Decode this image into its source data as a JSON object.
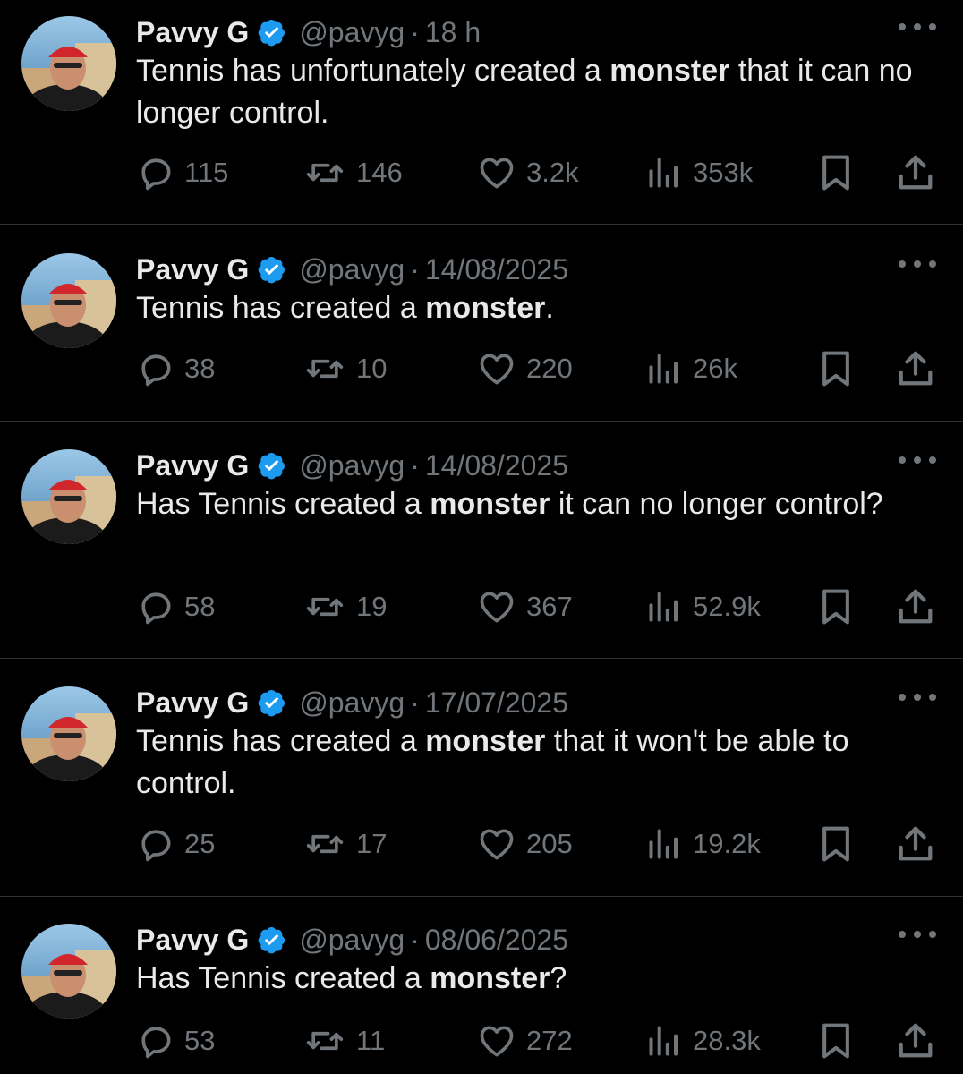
{
  "colors": {
    "background": "#000000",
    "text": "#e7e9ea",
    "muted": "#71767b",
    "verified": "#1d9bf0",
    "divider": "#2f3336"
  },
  "tweets": [
    {
      "name": "Pavvy G",
      "handle": "@pavyg",
      "separator": "·",
      "time": "18 h",
      "text_before": "Tennis has unfortunately created a ",
      "text_bold": "monster",
      "text_after": " that it can no longer control.",
      "replies": "115",
      "retweets": "146",
      "likes": "3.2k",
      "views": "353k"
    },
    {
      "name": "Pavvy G",
      "handle": "@pavyg",
      "separator": "·",
      "time": "14/08/2025",
      "text_before": "Tennis has created a ",
      "text_bold": "monster",
      "text_after": ".",
      "replies": "38",
      "retweets": "10",
      "likes": "220",
      "views": "26k"
    },
    {
      "name": "Pavvy G",
      "handle": "@pavyg",
      "separator": "·",
      "time": "14/08/2025",
      "text_before": "Has Tennis created a ",
      "text_bold": "monster",
      "text_after": " it can no longer control?",
      "replies": "58",
      "retweets": "19",
      "likes": "367",
      "views": "52.9k"
    },
    {
      "name": "Pavvy G",
      "handle": "@pavyg",
      "separator": "·",
      "time": "17/07/2025",
      "text_before": "Tennis has created a ",
      "text_bold": "monster",
      "text_after": " that it won't be able to control.",
      "replies": "25",
      "retweets": "17",
      "likes": "205",
      "views": "19.2k"
    },
    {
      "name": "Pavvy G",
      "handle": "@pavyg",
      "separator": "·",
      "time": "08/06/2025",
      "text_before": "Has Tennis created a ",
      "text_bold": "monster",
      "text_after": "?",
      "replies": "53",
      "retweets": "11",
      "likes": "272",
      "views": "28.3k"
    }
  ]
}
